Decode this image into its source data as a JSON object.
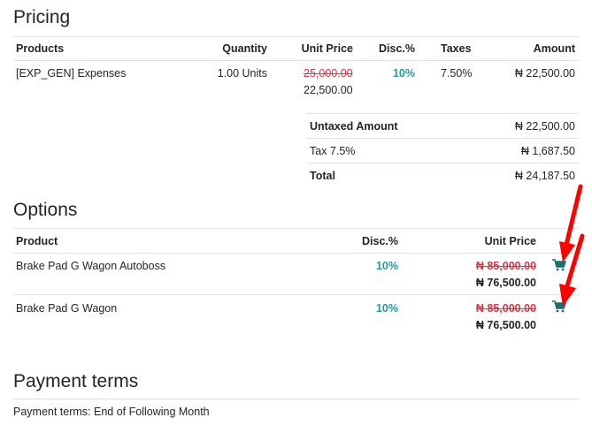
{
  "pricing": {
    "title": "Pricing",
    "headers": {
      "products": "Products",
      "quantity": "Quantity",
      "unit_price": "Unit Price",
      "disc": "Disc.%",
      "taxes": "Taxes",
      "amount": "Amount"
    },
    "row": {
      "product": "[EXP_GEN] Expenses",
      "quantity": "1.00 Units",
      "original_price": "25,000.00",
      "price": "22,500.00",
      "disc": "10%",
      "taxes": "7.50%",
      "amount": "₦ 22,500.00"
    },
    "totals": {
      "untaxed_label": "Untaxed Amount",
      "untaxed_value": "₦ 22,500.00",
      "tax_label": "Tax 7.5%",
      "tax_value": "₦ 1,687.50",
      "total_label": "Total",
      "total_value": "₦ 24,187.50"
    }
  },
  "options": {
    "title": "Options",
    "headers": {
      "product": "Product",
      "disc": "Disc.%",
      "unit_price": "Unit Price"
    },
    "rows": [
      {
        "product": "Brake Pad G Wagon Autoboss",
        "disc": "10%",
        "original_price": "₦ 85,000.00",
        "price": "₦ 76,500.00",
        "cart_icon": "shopping-cart-icon"
      },
      {
        "product": "Brake Pad G Wagon",
        "disc": "10%",
        "original_price": "₦ 85,000.00",
        "price": "₦ 76,500.00",
        "cart_icon": "shopping-cart-icon"
      }
    ]
  },
  "payment": {
    "title": "Payment terms",
    "text": "Payment terms: End of Following Month"
  },
  "colors": {
    "accent_teal": "#2d95a6",
    "strike_red": "#dc3545",
    "cart_teal": "#1a6f6f",
    "arrow_red": "#ff0000"
  }
}
